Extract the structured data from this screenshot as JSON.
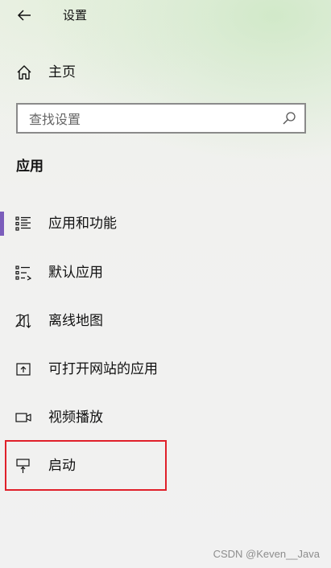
{
  "window": {
    "title": "设置",
    "back_icon": "arrow-left-icon"
  },
  "home": {
    "label": "主页",
    "icon": "home-icon"
  },
  "search": {
    "placeholder": "查找设置",
    "value": "",
    "icon": "search-icon"
  },
  "section": {
    "title": "应用"
  },
  "nav": {
    "items": [
      {
        "label": "应用和功能",
        "icon": "apps-list-icon",
        "selected": true
      },
      {
        "label": "默认应用",
        "icon": "default-apps-icon",
        "selected": false
      },
      {
        "label": "离线地图",
        "icon": "offline-map-icon",
        "selected": false
      },
      {
        "label": "可打开网站的应用",
        "icon": "web-apps-icon",
        "selected": false
      },
      {
        "label": "视频播放",
        "icon": "video-icon",
        "selected": false
      },
      {
        "label": "启动",
        "icon": "startup-icon",
        "selected": false
      }
    ]
  },
  "colors": {
    "accent": "#7b5dbb",
    "annotation_box": "#e0202a",
    "watermark_text": "#8d8d8d"
  },
  "watermark": {
    "text": "CSDN @Keven__Java"
  }
}
